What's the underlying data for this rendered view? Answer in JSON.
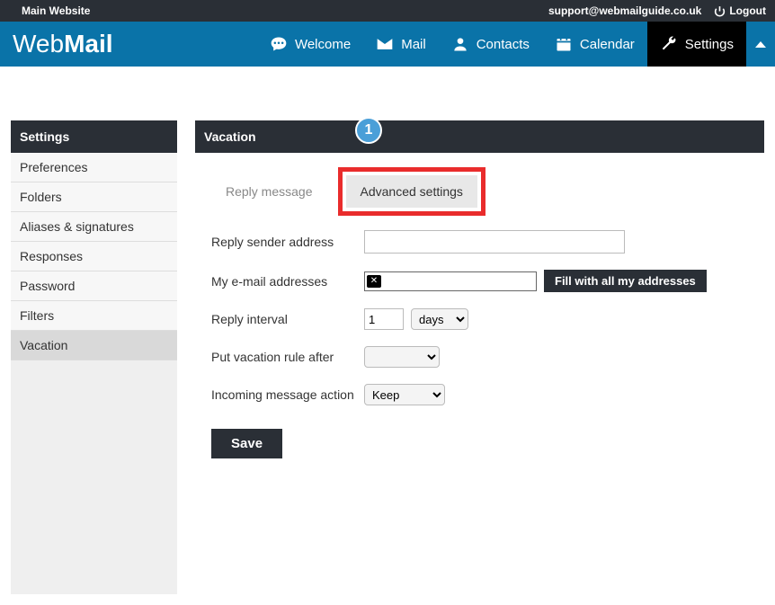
{
  "topbar": {
    "main_site": "Main Website",
    "support_email": "support@webmailguide.co.uk",
    "logout": "Logout"
  },
  "logo": {
    "part1": "Web",
    "part2": "Mail"
  },
  "nav": {
    "welcome": "Welcome",
    "mail": "Mail",
    "contacts": "Contacts",
    "calendar": "Calendar",
    "settings": "Settings"
  },
  "sidebar": {
    "title": "Settings",
    "items": [
      "Preferences",
      "Folders",
      "Aliases & signatures",
      "Responses",
      "Password",
      "Filters",
      "Vacation"
    ],
    "active_index": 6
  },
  "main": {
    "title": "Vacation",
    "step_badge": "1",
    "tabs": {
      "reply": "Reply message",
      "advanced": "Advanced settings"
    },
    "form": {
      "reply_sender_label": "Reply sender address",
      "reply_sender_value": "",
      "email_addr_label": "My e-mail addresses",
      "fill_all_btn": "Fill with all my addresses",
      "reply_interval_label": "Reply interval",
      "reply_interval_value": "1",
      "reply_interval_unit": "days",
      "put_after_label": "Put vacation rule after",
      "put_after_value": "",
      "incoming_label": "Incoming message action",
      "incoming_value": "Keep",
      "save_btn": "Save"
    }
  }
}
